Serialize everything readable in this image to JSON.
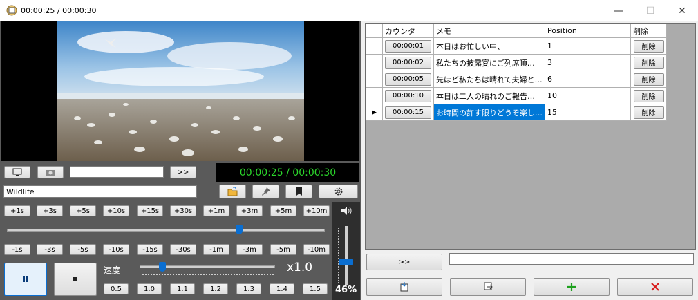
{
  "window": {
    "title": "00:00:25 / 00:00:30",
    "minimize": "—",
    "maximize": "☐",
    "close": "✕"
  },
  "player": {
    "time_display": "00:00:25 / 00:00:30",
    "file_name": "Wildlife",
    "empty_field": "",
    "forward_label": ">>",
    "seek_position": 0.73,
    "speed_label": "速度",
    "speed_value": "x1.0",
    "speed_position": 0.17,
    "volume_label": "46%",
    "volume_level": 0.46,
    "forward_buttons": [
      "+1s",
      "+3s",
      "+5s",
      "+10s",
      "+15s",
      "+30s",
      "+1m",
      "+3m",
      "+5m",
      "+10m"
    ],
    "backward_buttons": [
      "-1s",
      "-3s",
      "-5s",
      "-10s",
      "-15s",
      "-30s",
      "-1m",
      "-3m",
      "-5m",
      "-10m"
    ],
    "speed_buttons": [
      "0.5",
      "1.0",
      "1.1",
      "1.2",
      "1.3",
      "1.4",
      "1.5"
    ]
  },
  "memo_table": {
    "headers": [
      "カウンタ",
      "メモ",
      "Position",
      "削除"
    ],
    "rows": [
      {
        "counter": "00:00:01",
        "memo": "本日はお忙しい中、",
        "position": "1",
        "delete": "削除"
      },
      {
        "counter": "00:00:02",
        "memo": "私たちの披露宴にご列席頂…",
        "position": "3",
        "delete": "削除"
      },
      {
        "counter": "00:00:05",
        "memo": "先ほど私たちは晴れて夫婦と…",
        "position": "6",
        "delete": "削除"
      },
      {
        "counter": "00:00:10",
        "memo": "本日は二人の晴れのご報告…",
        "position": "10",
        "delete": "削除"
      },
      {
        "counter": "00:00:15",
        "memo": "お時間の許す限りどうぞ楽し…",
        "position": "15",
        "delete": "削除"
      }
    ],
    "selected_row": 4
  },
  "bottom": {
    "forward_label": ">>",
    "text_value": ""
  },
  "icons": {
    "monitor": "monitor-icon",
    "camera": "camera-icon",
    "folder": "folder-open-icon",
    "pin": "pin-icon",
    "bookmark": "bookmark-icon",
    "gear": "gear-icon",
    "speaker": "speaker-icon",
    "pause": "pause-icon",
    "stop": "stop-icon",
    "add": "plus-icon",
    "delete": "x-icon"
  },
  "colors": {
    "accent": "#0a6ed1",
    "time_green": "#2bd62b",
    "delete_red": "#d81b1b",
    "add_green": "#1fa11f"
  }
}
